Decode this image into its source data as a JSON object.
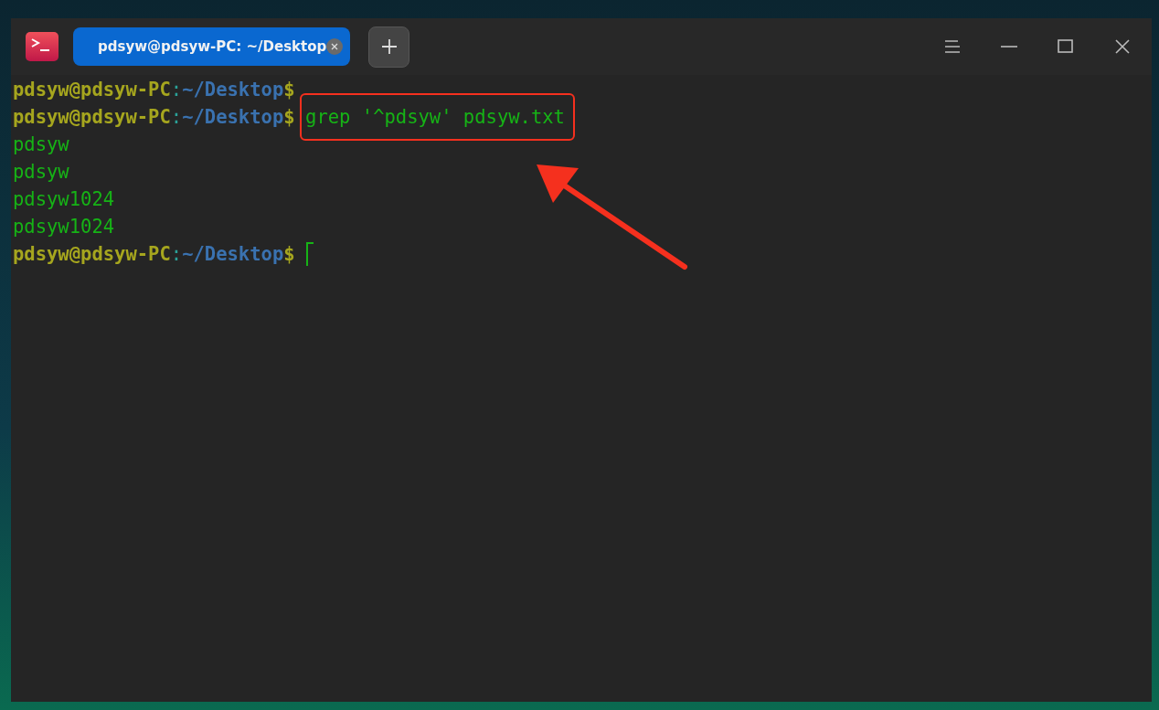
{
  "window": {
    "tabs": [
      {
        "label": "pdsyw@pdsyw-PC: ~/Desktop",
        "selected": true
      }
    ]
  },
  "terminal": {
    "lines": [
      {
        "kind": "prompt",
        "user": "pdsyw@pdsyw-PC",
        "separator": ":",
        "path": "~/Desktop",
        "symbol": "$"
      },
      {
        "kind": "prompt",
        "user": "pdsyw@pdsyw-PC",
        "separator": ":",
        "path": "~/Desktop",
        "symbol": "$",
        "command": "grep '^pdsyw' pdsyw.txt",
        "highlighted": true
      },
      {
        "kind": "output",
        "text": "pdsyw"
      },
      {
        "kind": "output",
        "text": "pdsyw"
      },
      {
        "kind": "output",
        "text": "pdsyw1024"
      },
      {
        "kind": "output",
        "text": "pdsyw1024"
      },
      {
        "kind": "prompt",
        "user": "pdsyw@pdsyw-PC",
        "separator": ":",
        "path": "~/Desktop",
        "symbol": "$",
        "cursor": true
      }
    ]
  }
}
